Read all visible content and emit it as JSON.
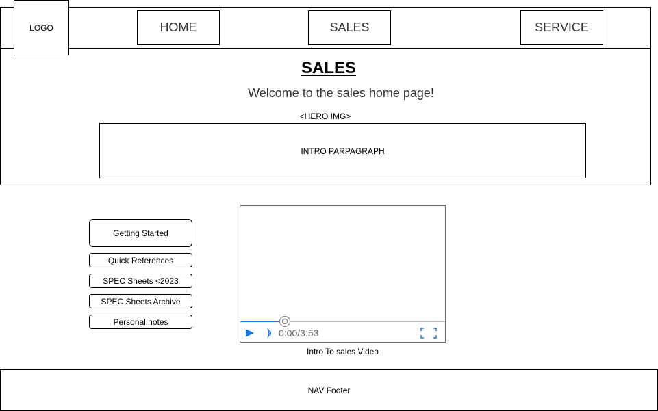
{
  "header": {
    "logo": "LOGO",
    "nav": {
      "home": "HOME",
      "sales": "SALES",
      "service": "SERVICE"
    }
  },
  "hero": {
    "title": "SALES ",
    "welcome": "Welcome to the sales home page!",
    "hero_img_label": "<HERO IMG>",
    "intro": "INTRO PARPAGRAPH"
  },
  "side_menu": {
    "items": [
      "Getting Started",
      "Quick References",
      "SPEC Sheets <2023",
      "SPEC Sheets Archive",
      "Personal notes"
    ]
  },
  "video": {
    "time": "0:00/3:53",
    "progress_fraction": 0.217,
    "caption": "Intro To sales Video",
    "icons": [
      "play-icon",
      "volume-icon",
      "fullscreen-icon"
    ],
    "accent_color": "#1a73e8"
  },
  "footer": {
    "label": "NAV Footer"
  }
}
